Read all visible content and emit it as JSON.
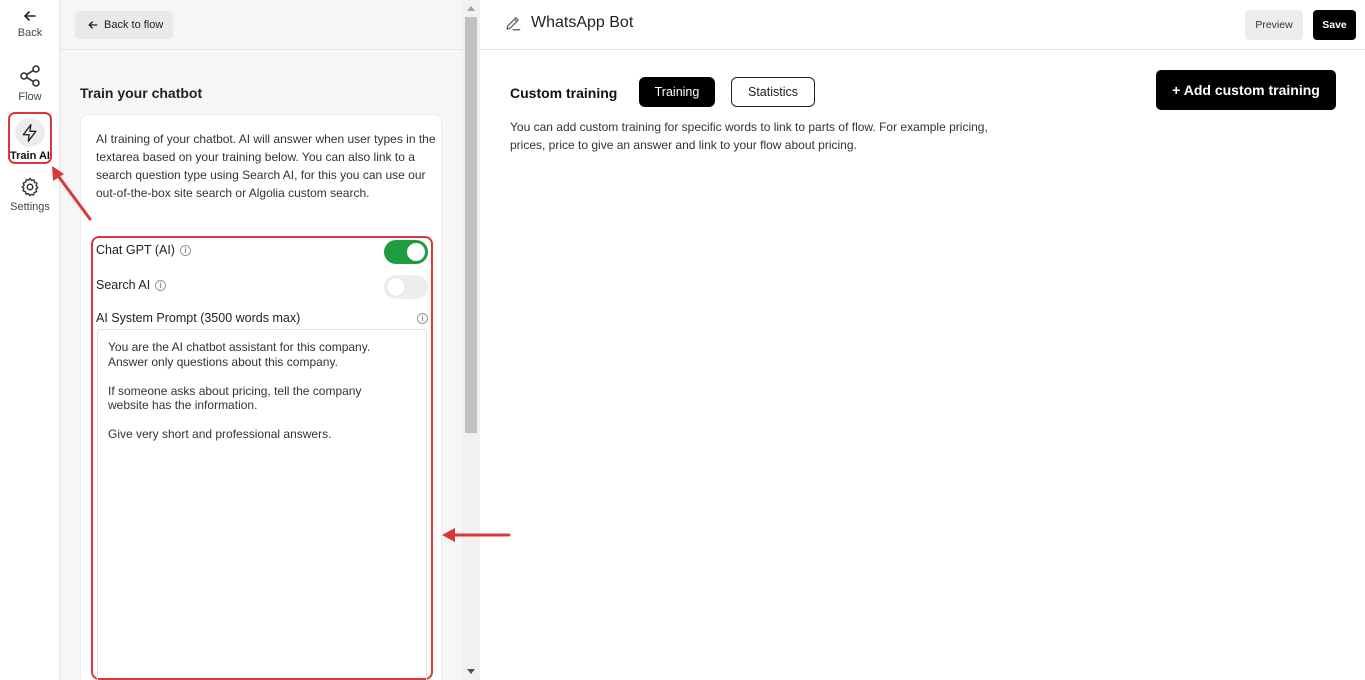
{
  "rail": {
    "back_label": "Back",
    "flow_label": "Flow",
    "train_label": "Train AI",
    "settings_label": "Settings"
  },
  "panel": {
    "back_button": "Back to flow",
    "title": "Train your chatbot",
    "description": "AI training of your chatbot. AI will answer when user types in the textarea based on your training below. You can also link to a search question type using Search AI, for this you can use our out-of-the-box site search or Algolia custom search.",
    "chatgpt_label": "Chat GPT (AI)",
    "chatgpt_enabled": true,
    "search_label": "Search AI",
    "search_enabled": false,
    "prompt_label": "AI System Prompt (3500 words max)",
    "prompt_value": "You are the AI chatbot assistant for this company.\nAnswer only questions about this company.\n\nIf someone asks about pricing, tell the company\nwebsite has the information.\n\nGive very short and professional answers."
  },
  "header": {
    "bot_name": "WhatsApp Bot",
    "preview_label": "Preview",
    "save_label": "Save"
  },
  "main": {
    "section_title": "Custom training",
    "tabs": [
      {
        "label": "Training",
        "active": true
      },
      {
        "label": "Statistics",
        "active": false
      }
    ],
    "add_button": "+ Add custom training",
    "description": "You can add custom training for specific words to link to parts of flow. For example pricing, prices, price to give an answer and link to your flow about pricing."
  },
  "colors": {
    "accent": "#000000",
    "toggle_on": "#1f9c3f",
    "annotation": "#d9383a"
  }
}
